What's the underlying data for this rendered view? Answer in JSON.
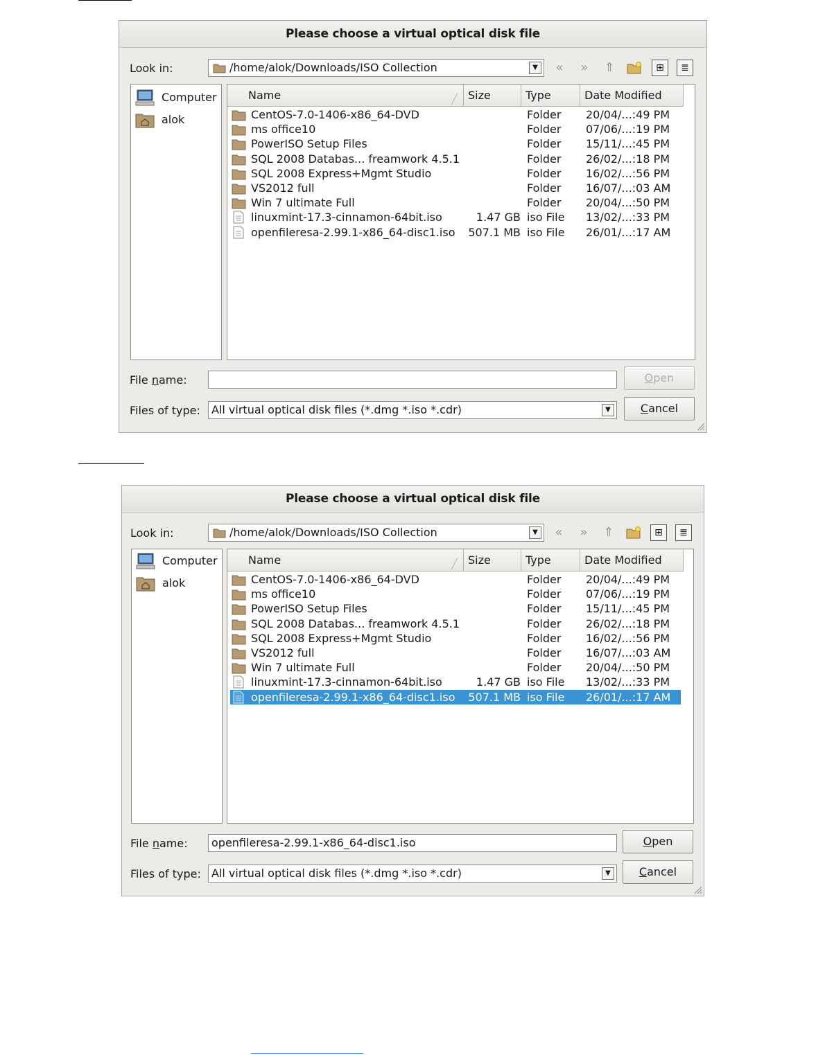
{
  "dialog1": {
    "title": "Please choose a virtual optical disk file",
    "look_in_label": "Look in:",
    "look_in_path": "/home/alok/Downloads/ISO Collection",
    "places": [
      {
        "label": "Computer",
        "icon": "computer-icon"
      },
      {
        "label": "alok",
        "icon": "home-folder-icon"
      }
    ],
    "columns": {
      "name": "Name",
      "size": "Size",
      "type": "Type",
      "date": "Date Modified"
    },
    "files": [
      {
        "name": "CentOS-7.0-1406-x86_64-DVD",
        "size": "",
        "type": "Folder",
        "date": "20/04/...:49 PM",
        "icon": "folder-icon"
      },
      {
        "name": "ms office10",
        "size": "",
        "type": "Folder",
        "date": "07/06/...:19 PM",
        "icon": "folder-icon"
      },
      {
        "name": "PowerISO Setup Files",
        "size": "",
        "type": "Folder",
        "date": "15/11/...:45 PM",
        "icon": "folder-icon"
      },
      {
        "name": "SQL 2008 Databas... freamwork 4.5.1",
        "size": "",
        "type": "Folder",
        "date": "26/02/...:18 PM",
        "icon": "folder-icon"
      },
      {
        "name": "SQL 2008 Express+Mgmt Studio",
        "size": "",
        "type": "Folder",
        "date": "16/02/...:56 PM",
        "icon": "folder-icon"
      },
      {
        "name": "VS2012 full",
        "size": "",
        "type": "Folder",
        "date": "16/07/...:03 AM",
        "icon": "folder-icon"
      },
      {
        "name": "Win 7 ultimate Full",
        "size": "",
        "type": "Folder",
        "date": "20/04/...:50 PM",
        "icon": "folder-icon"
      },
      {
        "name": "linuxmint-17.3-cinnamon-64bit.iso",
        "size": "1.47 GB",
        "type": "iso File",
        "date": "13/02/...:33 PM",
        "icon": "file-icon"
      },
      {
        "name": "openfileresa-2.99.1-x86_64-disc1.iso",
        "size": "507.1 MB",
        "type": "iso File",
        "date": "26/01/...:17 AM",
        "icon": "file-icon"
      }
    ],
    "file_name_label_pre": "File ",
    "file_name_label_u": "n",
    "file_name_label_post": "ame:",
    "file_name_value": "",
    "files_of_type_label": "Files of type:",
    "files_of_type_value": "All virtual optical disk files (*.dmg *.iso *.cdr)",
    "open_u": "O",
    "open_rest": "pen",
    "open_enabled": false,
    "cancel_u": "C",
    "cancel_rest": "ancel"
  },
  "dialog2": {
    "title": "Please choose a virtual optical disk file",
    "look_in_label": "Look in:",
    "look_in_path": "/home/alok/Downloads/ISO Collection",
    "places": [
      {
        "label": "Computer",
        "icon": "computer-icon"
      },
      {
        "label": "alok",
        "icon": "home-folder-icon"
      }
    ],
    "columns": {
      "name": "Name",
      "size": "Size",
      "type": "Type",
      "date": "Date Modified"
    },
    "files": [
      {
        "name": "CentOS-7.0-1406-x86_64-DVD",
        "size": "",
        "type": "Folder",
        "date": "20/04/...:49 PM",
        "icon": "folder-icon"
      },
      {
        "name": "ms office10",
        "size": "",
        "type": "Folder",
        "date": "07/06/...:19 PM",
        "icon": "folder-icon"
      },
      {
        "name": "PowerISO Setup Files",
        "size": "",
        "type": "Folder",
        "date": "15/11/...:45 PM",
        "icon": "folder-icon"
      },
      {
        "name": "SQL 2008 Databas... freamwork 4.5.1",
        "size": "",
        "type": "Folder",
        "date": "26/02/...:18 PM",
        "icon": "folder-icon"
      },
      {
        "name": "SQL 2008 Express+Mgmt Studio",
        "size": "",
        "type": "Folder",
        "date": "16/02/...:56 PM",
        "icon": "folder-icon"
      },
      {
        "name": "VS2012 full",
        "size": "",
        "type": "Folder",
        "date": "16/07/...:03 AM",
        "icon": "folder-icon"
      },
      {
        "name": "Win 7 ultimate Full",
        "size": "",
        "type": "Folder",
        "date": "20/04/...:50 PM",
        "icon": "folder-icon"
      },
      {
        "name": "linuxmint-17.3-cinnamon-64bit.iso",
        "size": "1.47 GB",
        "type": "iso File",
        "date": "13/02/...:33 PM",
        "icon": "file-icon"
      },
      {
        "name": "openfileresa-2.99.1-x86_64-disc1.iso",
        "size": "507.1 MB",
        "type": "iso File",
        "date": "26/01/...:17 AM",
        "icon": "file-icon",
        "selected": true
      }
    ],
    "file_name_label_pre": "File ",
    "file_name_label_u": "n",
    "file_name_label_post": "ame:",
    "file_name_value": "openfileresa-2.99.1-x86_64-disc1.iso",
    "files_of_type_label": "Files of type:",
    "files_of_type_value": "All virtual optical disk files (*.dmg *.iso *.cdr)",
    "open_u": "O",
    "open_rest": "pen",
    "open_enabled": true,
    "cancel_u": "C",
    "cancel_rest": "ancel"
  },
  "colors": {
    "selection": "#3a93d5",
    "dialog_bg": "#edebe8",
    "folder": "#b59a72"
  }
}
